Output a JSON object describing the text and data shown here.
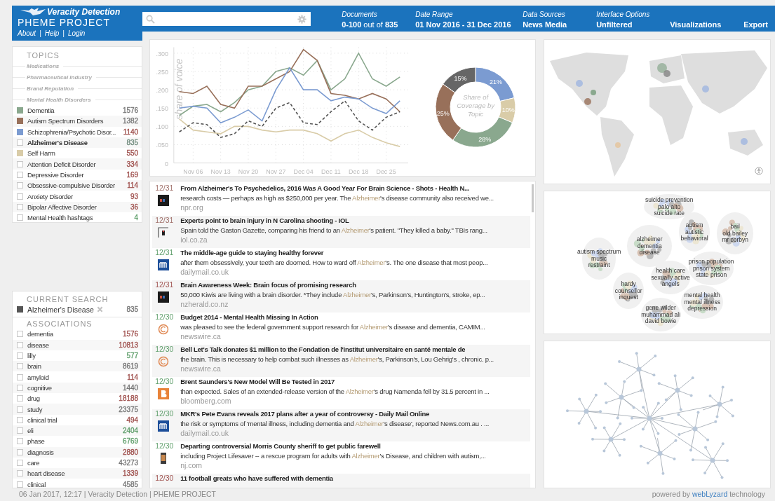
{
  "header": {
    "logo_title": "Veracity Detection",
    "logo_subtitle": "PHEME PROJECT",
    "nav": [
      "About",
      "Help",
      "Login"
    ],
    "nav_separator": "|",
    "stats": [
      {
        "kind": "count",
        "label": "Documents",
        "value": "**0-100** out of **835**"
      },
      {
        "kind": "stat",
        "label": "Date Range",
        "value": "01 Nov 2016 - 31 Dec 2016"
      },
      {
        "kind": "stat",
        "label": "Data Sources",
        "value": "News Media"
      },
      {
        "kind": "stat",
        "label": "Interface Options",
        "value": "Unfiltered"
      },
      {
        "kind": "button",
        "value": "Visualizations"
      },
      {
        "kind": "button",
        "value": "Export"
      }
    ]
  },
  "topics": {
    "title": "TOPICS",
    "groups": [
      {
        "label": "Medications"
      },
      {
        "label": "Pharmaceutical Industry"
      },
      {
        "label": "Brand Reputation"
      },
      {
        "label": "Mental Health Disorders",
        "items": [
          {
            "kind": "swatch",
            "color": "#8aa88e",
            "label": "Dementia",
            "count": {
              "text": "1576",
              "color": "#777777"
            },
            "selected": false
          },
          {
            "kind": "swatch",
            "color": "#98705a",
            "label": "Autism Spectrum Disorders",
            "count": {
              "text": "1382",
              "color": "#777777"
            },
            "selected": false
          },
          {
            "kind": "swatch",
            "color": "#7b9bd1",
            "label": "Schizophrenia/Psychotic Disor...",
            "count": {
              "text": "1140",
              "color": "#a0524f"
            },
            "selected": false
          },
          {
            "kind": "checkbox",
            "checked": false,
            "label": "Alzheimer's Disease",
            "count": {
              "text": "835",
              "color": "#6f8a7c"
            },
            "selected": true
          },
          {
            "kind": "swatch",
            "color": "#d9cca8",
            "label": "Self Harm",
            "count": {
              "text": "550",
              "color": "#a0524f"
            },
            "selected": false
          },
          {
            "kind": "checkbox",
            "checked": false,
            "label": "Attention Deficit Disorder",
            "count": {
              "text": "334",
              "color": "#a0524f"
            },
            "selected": false
          },
          {
            "kind": "checkbox",
            "checked": false,
            "label": "Depressive Disorder",
            "count": {
              "text": "169",
              "color": "#a0524f"
            },
            "selected": false
          },
          {
            "kind": "checkbox",
            "checked": false,
            "label": "Obsessive-compulsive Disorder",
            "count": {
              "text": "114",
              "color": "#a0524f"
            },
            "selected": false
          },
          {
            "kind": "checkbox",
            "checked": false,
            "label": "Anxiety Disorder",
            "count": {
              "text": "93",
              "color": "#a0524f"
            },
            "selected": false
          },
          {
            "kind": "checkbox",
            "checked": false,
            "label": "Bipolar Affective Disorder",
            "count": {
              "text": "36",
              "color": "#a0524f"
            },
            "selected": false
          },
          {
            "kind": "checkbox",
            "checked": false,
            "label": "Mental Health hashtags",
            "count": {
              "text": "4",
              "color": "#5e9e6a"
            },
            "selected": false
          }
        ]
      }
    ]
  },
  "current_search": {
    "title": "CURRENT SEARCH",
    "color": "#555555",
    "label": "Alzheimer's Disease",
    "count": "835"
  },
  "associations": {
    "title": "ASSOCIATIONS",
    "items": [
      {
        "label": "dementia",
        "count": {
          "text": "1576",
          "color": "#a0524f"
        },
        "checked": false
      },
      {
        "label": "disease",
        "count": {
          "text": "10813",
          "color": "#a0524f"
        },
        "checked": false
      },
      {
        "label": "lilly",
        "count": {
          "text": "577",
          "color": "#5e9e6a"
        },
        "checked": false
      },
      {
        "label": "brain",
        "count": {
          "text": "8619",
          "color": "#777777"
        },
        "checked": false
      },
      {
        "label": "amyloid",
        "count": {
          "text": "114",
          "color": "#a0524f"
        },
        "checked": false
      },
      {
        "label": "cognitive",
        "count": {
          "text": "1440",
          "color": "#777777"
        },
        "checked": false
      },
      {
        "label": "drug",
        "count": {
          "text": "18188",
          "color": "#a0524f"
        },
        "checked": false
      },
      {
        "label": "study",
        "count": {
          "text": "23375",
          "color": "#777777"
        },
        "checked": false
      },
      {
        "label": "clinical trial",
        "count": {
          "text": "494",
          "color": "#a0524f"
        },
        "checked": false
      },
      {
        "label": "eli",
        "count": {
          "text": "2404",
          "color": "#5e9e6a"
        },
        "checked": false
      },
      {
        "label": "phase",
        "count": {
          "text": "6769",
          "color": "#5e9e6a"
        },
        "checked": false
      },
      {
        "label": "diagnosis",
        "count": {
          "text": "2880",
          "color": "#a0524f"
        },
        "checked": false
      },
      {
        "label": "care",
        "count": {
          "text": "43273",
          "color": "#777777"
        },
        "checked": false
      },
      {
        "label": "heart disease",
        "count": {
          "text": "1339",
          "color": "#a0524f"
        },
        "checked": false
      },
      {
        "label": "clinical",
        "count": {
          "text": "4585",
          "color": "#777777"
        },
        "checked": false
      }
    ]
  },
  "chart": {
    "chart_data": {
      "type": "line",
      "grid": true,
      "ylabel": "share of voice",
      "categories": [
        null,
        "Nov 06",
        null,
        "Nov 13",
        null,
        "Nov 20",
        null,
        "Nov 27",
        null,
        "Dec 04",
        null,
        "Dec 11",
        null,
        "Dec 18",
        null,
        "Dec 25",
        null
      ],
      "ylim": [
        0,
        0.32
      ],
      "yticks": [
        {
          "value": 0,
          "label": "0"
        },
        {
          "value": 0.05,
          "label": ".050"
        },
        {
          "value": 0.1,
          "label": ".100"
        },
        {
          "value": 0.15,
          "label": ".150"
        },
        {
          "value": 0.2,
          "label": ".200"
        },
        {
          "value": 0.25,
          "label": ".250"
        },
        {
          "value": 0.3,
          "label": ".300"
        }
      ],
      "series": [
        {
          "color": "#8aa88e",
          "line_style": "solid",
          "values": [
            0.13,
            0.155,
            0.16,
            0.14,
            0.165,
            0.2,
            0.21,
            0.25,
            0.26,
            0.24,
            0.28,
            0.2,
            0.23,
            0.3,
            0.23,
            0.21,
            0.235
          ]
        },
        {
          "color": "#98705a",
          "line_style": "solid",
          "values": [
            0.195,
            0.19,
            0.21,
            0.16,
            0.15,
            0.21,
            0.21,
            0.23,
            0.25,
            0.31,
            0.28,
            0.19,
            0.185,
            0.175,
            0.19,
            0.175,
            0.14
          ]
        },
        {
          "color": "#7b9bd1",
          "line_style": "solid",
          "values": [
            0.15,
            0.155,
            0.15,
            0.11,
            0.125,
            0.145,
            0.115,
            0.2,
            0.26,
            0.2,
            0.2,
            0.17,
            0.18,
            0.175,
            0.15,
            0.135,
            0.17
          ]
        },
        {
          "color": "#d9cca8",
          "line_style": "solid",
          "values": [
            0.12,
            0.09,
            0.085,
            0.08,
            0.1,
            0.1,
            0.09,
            0.085,
            0.09,
            0.09,
            0.08,
            0.06,
            0.08,
            0.09,
            0.07,
            0.055,
            0.045
          ]
        },
        {
          "color": "#555555",
          "line_style": "dashed",
          "values": [
            0.085,
            0.11,
            0.105,
            0.07,
            0.08,
            0.115,
            0.1,
            0.15,
            0.165,
            0.11,
            0.105,
            0.14,
            0.17,
            0.115,
            0.09,
            0.125,
            0.14
          ]
        }
      ]
    }
  },
  "donut": {
    "chart_data": {
      "type": "donut",
      "title": "Share of Coverage by Topic",
      "series": [
        {
          "values": [
            21,
            10,
            28,
            25,
            15
          ],
          "colors": [
            "#7b9bd1",
            "#d9cca8",
            "#8aa88e",
            "#98705a",
            "#666666"
          ]
        }
      ],
      "value_labels": [
        "21%",
        "10%",
        "28%",
        "25%",
        "15%"
      ]
    }
  },
  "news": [
    {
      "date": {
        "text": "12/31",
        "color": "#a0706a"
      },
      "logo": {
        "kind": "dark"
      },
      "title": "From Alzheimer's To Psychedelics, 2016 Was A Good Year For Brain Science - Shots - Health N...",
      "before": "research costs — perhaps as high as $250,000 per year. The ",
      "highlight": "Alzheimer",
      "after": "'s disease community also received we...",
      "source": "npr.org"
    },
    {
      "date": {
        "text": "12/31",
        "color": "#a0706a"
      },
      "logo": {
        "kind": "frame"
      },
      "title": "Experts point to brain injury in N Carolina shooting - IOL",
      "before": "Spain told the Gaston Gazette, comparing his friend to an ",
      "highlight": "Alzheimer",
      "after": "'s patient. \"They killed a baby.\" TBIs rang...",
      "source": "iol.co.za"
    },
    {
      "date": {
        "text": "12/31",
        "color": "#5e9e6a"
      },
      "logo": {
        "kind": "blue"
      },
      "title": "The middle-age guide to staying healthy forever",
      "before": "after them obsessively, your teeth are doomed. How to ward off ",
      "highlight": "Alzheimer",
      "after": "'s. The one disease that most peop...",
      "source": "dailymail.co.uk"
    },
    {
      "date": {
        "text": "12/31",
        "color": "#a0524f"
      },
      "logo": {
        "kind": "dark"
      },
      "title": "Brain Awareness Week: Brain focus of promising research",
      "before": "50,000 Kiwis are living with a brain disorder. *They include ",
      "highlight": "Alzheimer",
      "after": "'s, Parkinson's, Huntington's, stroke, ep...",
      "source": "nzherald.co.nz"
    },
    {
      "date": {
        "text": "12/30",
        "color": "#5e9e6a"
      },
      "logo": {
        "kind": "ring"
      },
      "title": "Budget 2014 - Mental Health Missing In Action",
      "before": "was pleased to see the federal government support research for ",
      "highlight": "Alzheimer",
      "after": "'s disease and dementia, CAMIM...",
      "source": "newswire.ca"
    },
    {
      "date": {
        "text": "12/30",
        "color": "#5e9e6a"
      },
      "logo": {
        "kind": "ring"
      },
      "title": "Bell Let's Talk donates $1 million to the Fondation de l'institut universitaire en santé mentale de",
      "before": "the brain. This is necessary to help combat such illnesses as ",
      "highlight": "Alzheimer",
      "after": "'s, Parkinson's, Lou Gehrig's , chronic. p...",
      "source": "newswire.ca"
    },
    {
      "date": {
        "text": "12/30",
        "color": "#5e9e6a"
      },
      "logo": {
        "kind": "orange"
      },
      "title": "Brent Saunders's New Model Will Be Tested in 2017",
      "before": "than expected. Sales of an extended-release version of the ",
      "highlight": "Alzheimer",
      "after": "'s drug Namenda fell by 31.5 percent in ...",
      "source": "bloomberg.com"
    },
    {
      "date": {
        "text": "12/30",
        "color": "#5e9e6a"
      },
      "logo": {
        "kind": "blue"
      },
      "title": "MKR's Pete Evans reveals 2017 plans after a year of controversy - Daily Mail Online",
      "before": "the risk or symptoms of 'mental illness, including dementia and ",
      "highlight": "Alzheimer",
      "after": "'s disease', reported News.com.au . ...",
      "source": "dailymail.co.uk"
    },
    {
      "date": {
        "text": "12/30",
        "color": "#5e9e6a"
      },
      "title": "Departing controversial Morris County sheriff to get public farewell",
      "before": "including Project Lifesaver -- a rescue program for adults with ",
      "highlight": "Alzheimer",
      "after": "'s Disease, and children with autism,...",
      "source": "nj.com"
    },
    {
      "date": {
        "text": "12/30",
        "color": "#a0524f"
      },
      "title": "11 football greats who have suffered with dementia"
    }
  ],
  "clusters": [
    {
      "terms": [
        "suicide prevention",
        "palo alto",
        "suicide rate"
      ]
    },
    {
      "terms": [
        "autism",
        "autistic",
        "behavioral"
      ]
    },
    {
      "terms": [
        "bail",
        "old bailey",
        "mr corbyn"
      ]
    },
    {
      "terms": [
        "alzheimer",
        "dementia",
        "disease"
      ]
    },
    {
      "terms": [
        "autism spectrum",
        "music",
        "restraint"
      ]
    },
    {
      "terms": [
        "prison population",
        "prison system",
        "state prison"
      ]
    },
    {
      "terms": [
        "health care",
        "sexually active",
        "angels"
      ]
    },
    {
      "terms": [
        "hardy",
        "counsellor",
        "inquest"
      ]
    },
    {
      "terms": [
        "mental health",
        "mental illness",
        "depression"
      ]
    },
    {
      "terms": [
        "gene wilder",
        "muhammad ali",
        "david bowie"
      ]
    }
  ],
  "footer": {
    "text": "06 Jan 2017, 12:17 | Veracity Detection | PHEME PROJECT",
    "powered_before": "powered by ",
    "powered_brand": "webLyzard",
    "powered_after": " technology"
  }
}
